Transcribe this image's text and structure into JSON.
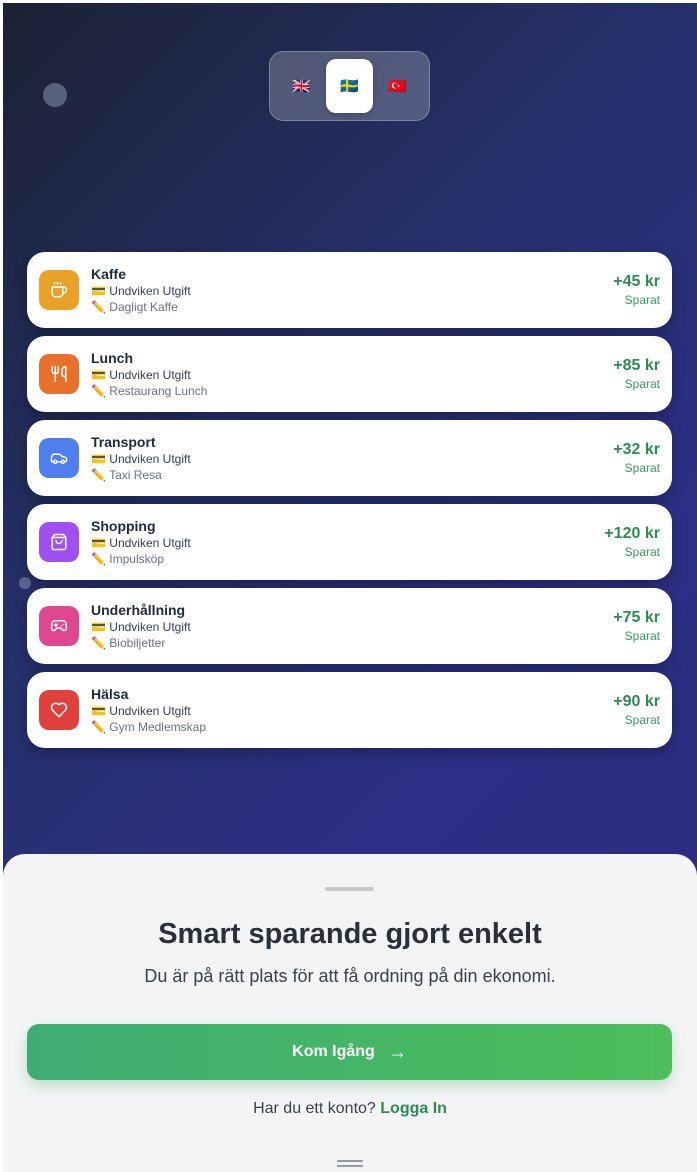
{
  "languages": [
    {
      "flag": "🇬🇧",
      "code": "en",
      "active": false
    },
    {
      "flag": "🇸🇪",
      "code": "sv",
      "active": true
    },
    {
      "flag": "🇹🇷",
      "code": "tr",
      "active": false
    }
  ],
  "savings": [
    {
      "title": "Kaffe",
      "type_icon": "💳",
      "type": "Undviken Utgift",
      "note_icon": "✏️",
      "note": "Dagligt Kaffe",
      "amount": "+45 kr",
      "amount_label": "Sparat",
      "icon": "coffee-icon",
      "color": "#e9a127"
    },
    {
      "title": "Lunch",
      "type_icon": "💳",
      "type": "Undviken Utgift",
      "note_icon": "✏️",
      "note": "Restaurang Lunch",
      "amount": "+85 kr",
      "amount_label": "Sparat",
      "icon": "utensils-icon",
      "color": "#e8702a"
    },
    {
      "title": "Transport",
      "type_icon": "💳",
      "type": "Undviken Utgift",
      "note_icon": "✏️",
      "note": "Taxi Resa",
      "amount": "+32 kr",
      "amount_label": "Sparat",
      "icon": "car-icon",
      "color": "#4f7ef0"
    },
    {
      "title": "Shopping",
      "type_icon": "💳",
      "type": "Undviken Utgift",
      "note_icon": "✏️",
      "note": "Impulsköp",
      "amount": "+120 kr",
      "amount_label": "Sparat",
      "icon": "shopping-bag-icon",
      "color": "#a04ff0"
    },
    {
      "title": "Underhållning",
      "type_icon": "💳",
      "type": "Undviken Utgift",
      "note_icon": "✏️",
      "note": "Biobiljetter",
      "amount": "+75 kr",
      "amount_label": "Sparat",
      "icon": "gamepad-icon",
      "color": "#e04791"
    },
    {
      "title": "Hälsa",
      "type_icon": "💳",
      "type": "Undviken Utgift",
      "note_icon": "✏️",
      "note": "Gym Medlemskap",
      "amount": "+90 kr",
      "amount_label": "Sparat",
      "icon": "heart-icon",
      "color": "#e0413d"
    }
  ],
  "sheet": {
    "title": "Smart sparande gjort enkelt",
    "subtitle": "Du är på rätt plats för att få ordning på din ekonomi.",
    "cta_label": "Kom Igång",
    "cta_arrow": "→",
    "login_prompt": "Har du ett konto?",
    "login_link": "Logga In"
  },
  "colors": {
    "accent_green": "#2f8a53",
    "cta_start": "#3dad73",
    "cta_end": "#4cbe5b"
  }
}
